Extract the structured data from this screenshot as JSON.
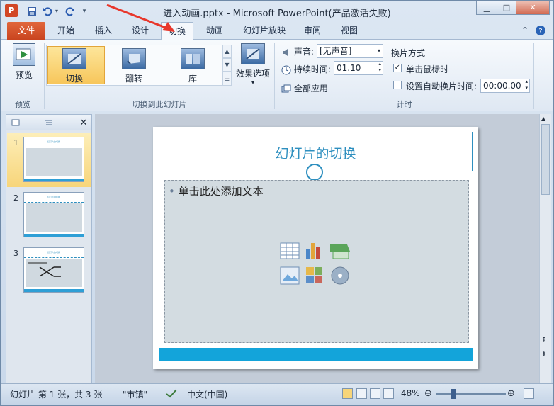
{
  "window": {
    "title": "进入动画.pptx - Microsoft PowerPoint(产品激活失败)",
    "app_icon": "P"
  },
  "tabs": {
    "file": "文件",
    "home": "开始",
    "insert": "插入",
    "design": "设计",
    "transitions": "切换",
    "animations": "动画",
    "slideshow": "幻灯片放映",
    "review": "审阅",
    "view": "视图"
  },
  "ribbon": {
    "preview_btn": "预览",
    "preview_group": "预览",
    "gallery": {
      "items": [
        "切换",
        "翻转",
        "库"
      ]
    },
    "effect_options": "效果选项",
    "transition_group": "切换到此幻灯片",
    "sound_label": "声音:",
    "sound_value": "[无声音]",
    "duration_label": "持续时间:",
    "duration_value": "01.10",
    "apply_all": "全部应用",
    "advance_title": "换片方式",
    "on_click_label": "单击鼠标时",
    "on_click_checked": true,
    "after_label": "设置自动换片时间:",
    "after_value": "00:00.00",
    "after_checked": false,
    "timing_group": "计时"
  },
  "slides": [
    {
      "num": "1",
      "title": "幻灯片的切换"
    },
    {
      "num": "2",
      "title": "幻灯片的切换"
    },
    {
      "num": "3",
      "title": "幻灯片的切换"
    }
  ],
  "slide": {
    "title": "幻灯片的切换",
    "body": "单击此处添加文本"
  },
  "status": {
    "slide_info": "幻灯片 第 1 张，共 3 张",
    "theme": "\"市镇\"",
    "language": "中文(中国)",
    "zoom": "48%"
  },
  "colors": {
    "accent": "#2e8fbf",
    "file_tab": "#d24726",
    "selected": "#f7c65b"
  }
}
